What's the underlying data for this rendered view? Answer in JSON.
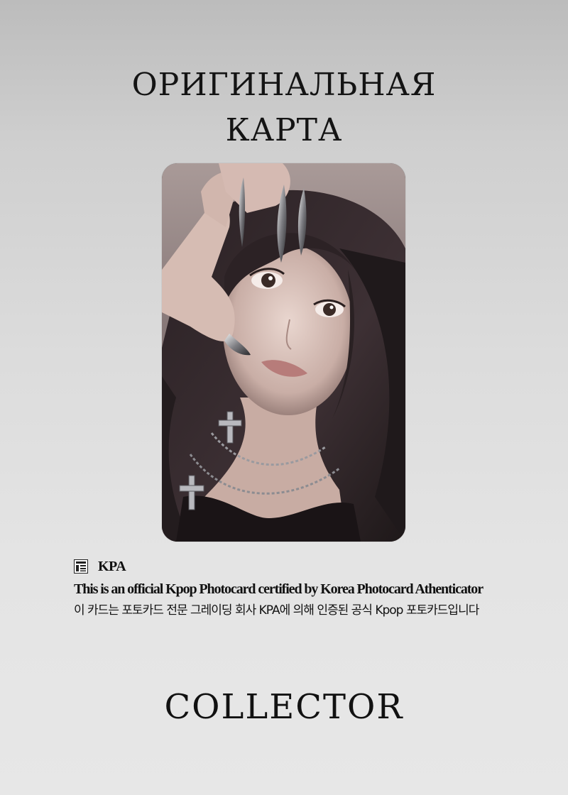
{
  "header": {
    "title_line1": "ОРИГИНАЛЬНАЯ",
    "title_line2": "КАРТА"
  },
  "photocard": {
    "description": "photocard-image"
  },
  "certification": {
    "brand": "KPA",
    "logo_icon": "kpa-logo-icon",
    "text_en": "This is an official Kpop Photocard certified by Korea Photocard Athenticator",
    "text_ko": "이 카드는 포토카드 전문 그레이딩 회사 KPA에 의해 인증된 공식 Kpop 포토카드입니다"
  },
  "footer": {
    "label": "COLLECTOR"
  },
  "colors": {
    "background_top": "#bcbcbc",
    "background_bottom": "#e7e7e7",
    "text": "#111111"
  }
}
